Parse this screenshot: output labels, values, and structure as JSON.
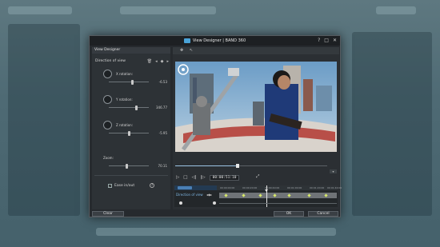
{
  "dialog": {
    "title": "View Designer | BAND 360",
    "window_buttons": [
      "?",
      "□",
      "✕"
    ]
  },
  "left_panel": {
    "header": "View Designer",
    "section_title": "Direction of view",
    "controls": [
      {
        "label": "X rotation:",
        "value": "-6.53",
        "level": 0.6
      },
      {
        "label": "Y rotation:",
        "value": "346.77",
        "level": 0.7
      },
      {
        "label": "Z rotation:",
        "value": "-5.95",
        "level": 0.5
      },
      {
        "label": "Zoom:",
        "value": "70.11",
        "level": 0.45
      }
    ],
    "ease_checkbox": {
      "label": "Ease in/out",
      "checked": true
    },
    "help": "?"
  },
  "player": {
    "timecode": "00:00:51:10",
    "playback_buttons": [
      "▷",
      "□",
      "◁|",
      "|▷",
      "⤢"
    ],
    "progress": 0.41
  },
  "timeline": {
    "track_label": "Direction of view",
    "ruler_ticks": [
      "00:00:00:00",
      "00:00:20:00",
      "00:00:40:00",
      "00:01:00:00",
      "00:01:20:00",
      "00:01:40:00"
    ],
    "keyframes": [
      0.05,
      0.2,
      0.35,
      0.47,
      0.6,
      0.77,
      0.92
    ]
  },
  "footer": {
    "clear": "Clear",
    "ok": "OK",
    "cancel": "Cancel"
  }
}
